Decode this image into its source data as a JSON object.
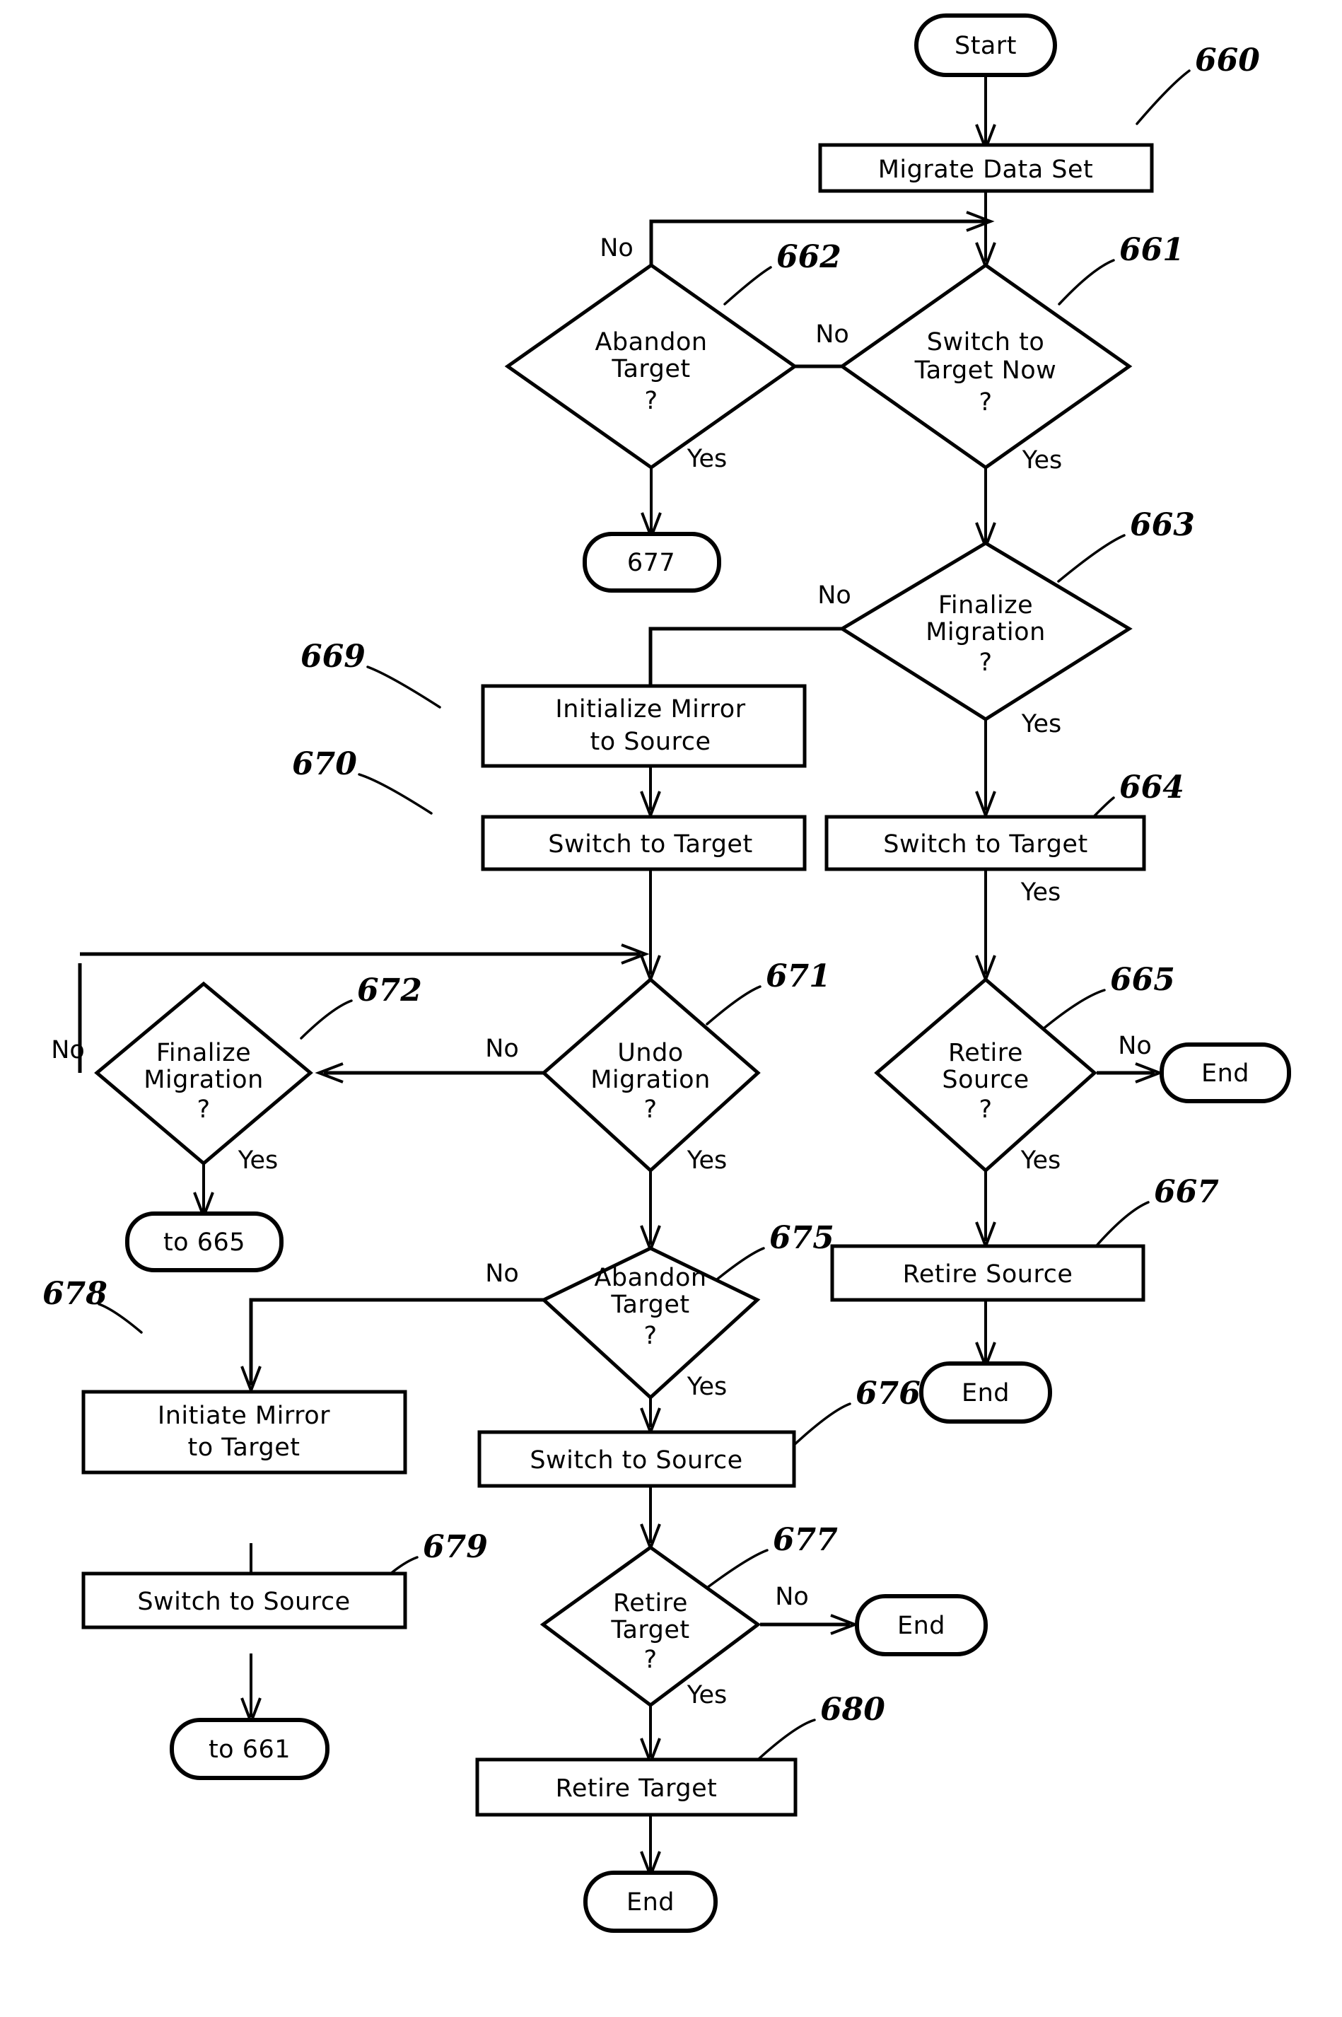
{
  "diagram": {
    "title": "Data Set Migration Flowchart",
    "type": "flowchart",
    "background_color": "#ffffff",
    "line_color": "#000000"
  },
  "nodes": {
    "start": {
      "label": "Start",
      "shape": "terminator"
    },
    "n660": {
      "label": "Migrate Data Set",
      "shape": "process",
      "ref": "660"
    },
    "n661": {
      "label_line1": "Switch to",
      "label_line2": "Target Now",
      "label_line3": "?",
      "shape": "decision",
      "ref": "661"
    },
    "n662": {
      "label_line1": "Abandon",
      "label_line2": "Target",
      "label_line3": "?",
      "shape": "decision",
      "ref": "662"
    },
    "off677a": {
      "label": "677",
      "shape": "connector"
    },
    "n663": {
      "label_line1": "Finalize",
      "label_line2": "Migration",
      "label_line3": "?",
      "shape": "decision",
      "ref": "663"
    },
    "n669": {
      "label_line1": "Initialize Mirror",
      "label_line2": "to Source",
      "shape": "process",
      "ref": "669"
    },
    "n670": {
      "label": "Switch to Target",
      "shape": "process",
      "ref": "670"
    },
    "n664": {
      "label": "Switch to Target",
      "shape": "process",
      "ref": "664"
    },
    "n671": {
      "label_line1": "Undo",
      "label_line2": "Migration",
      "label_line3": "?",
      "shape": "decision",
      "ref": "671"
    },
    "n672": {
      "label_line1": "Finalize",
      "label_line2": "Migration",
      "label_line3": "?",
      "shape": "decision",
      "ref": "672"
    },
    "n665": {
      "label_line1": "Retire",
      "label_line2": "Source",
      "label_line3": "?",
      "shape": "decision",
      "ref": "665"
    },
    "end665no": {
      "label": "End",
      "shape": "terminator"
    },
    "off665": {
      "label": "to 665",
      "shape": "connector"
    },
    "n675": {
      "label_line1": "Abandon",
      "label_line2": "Target",
      "label_line3": "?",
      "shape": "decision",
      "ref": "675"
    },
    "n667": {
      "label": "Retire Source",
      "shape": "process",
      "ref": "667"
    },
    "end667": {
      "label": "End",
      "shape": "terminator"
    },
    "n678": {
      "label_line1": "Initiate Mirror",
      "label_line2": "to Target",
      "shape": "process",
      "ref": "678"
    },
    "n676": {
      "label": "Switch to Source",
      "shape": "process",
      "ref": "676"
    },
    "n679": {
      "label": "Switch to Source",
      "shape": "process",
      "ref": "679"
    },
    "off661": {
      "label": "to 661",
      "shape": "connector"
    },
    "n677": {
      "label_line1": "Retire",
      "label_line2": "Target",
      "label_line3": "?",
      "shape": "decision",
      "ref": "677"
    },
    "end677no": {
      "label": "End",
      "shape": "terminator"
    },
    "n680": {
      "label": "Retire Target",
      "shape": "process",
      "ref": "680"
    },
    "end680": {
      "label": "End",
      "shape": "terminator"
    }
  },
  "edge_labels": {
    "l662_no": "No",
    "l662_yes": "Yes",
    "l661_no": "No",
    "l661_yes": "Yes",
    "l663_no": "No",
    "l663_yes": "Yes",
    "l664_yes": "Yes",
    "l665_no": "No",
    "l665_yes": "Yes",
    "l671_no": "No",
    "l671_yes": "Yes",
    "l672_no": "No",
    "l672_yes": "Yes",
    "l675_no": "No",
    "l675_yes": "Yes",
    "l677_no": "No",
    "l677_yes": "Yes"
  },
  "reference_numerals": {
    "r660": "660",
    "r661": "661",
    "r662": "662",
    "r663": "663",
    "r664": "664",
    "r665": "665",
    "r667": "667",
    "r669": "669",
    "r670": "670",
    "r671": "671",
    "r672": "672",
    "r675": "675",
    "r676": "676",
    "r677": "677",
    "r678": "678",
    "r679": "679",
    "r680": "680"
  }
}
